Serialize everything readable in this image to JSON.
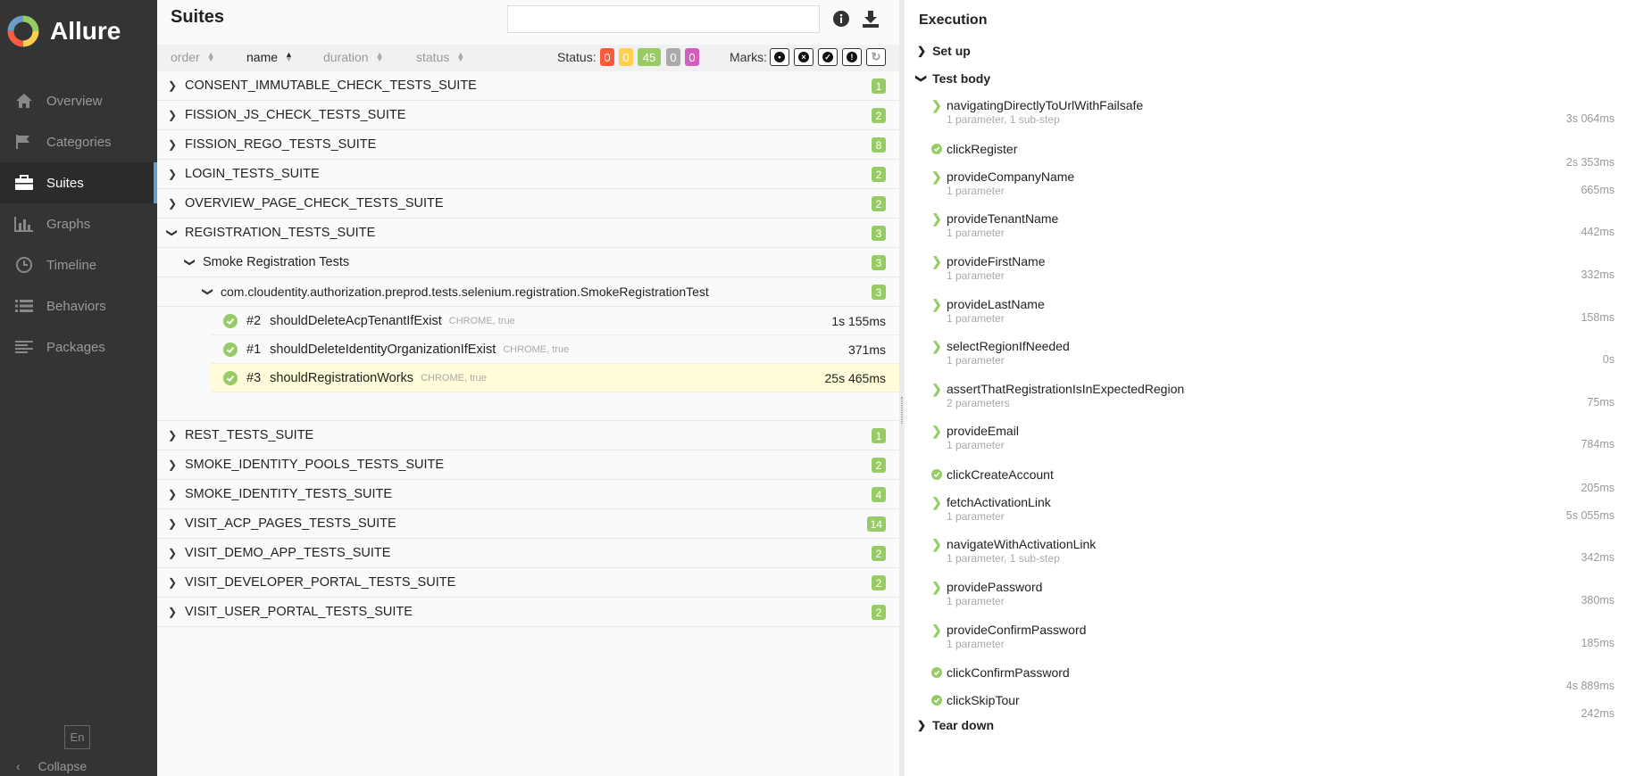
{
  "brand": {
    "name": "Allure"
  },
  "nav": [
    {
      "label": "Overview",
      "icon": "home-icon"
    },
    {
      "label": "Categories",
      "icon": "flag-icon"
    },
    {
      "label": "Suites",
      "icon": "briefcase-icon",
      "active": true
    },
    {
      "label": "Graphs",
      "icon": "bar-chart-icon"
    },
    {
      "label": "Timeline",
      "icon": "clock-icon"
    },
    {
      "label": "Behaviors",
      "icon": "list-icon"
    },
    {
      "label": "Packages",
      "icon": "align-left-icon"
    }
  ],
  "sidebar_footer": {
    "lang": "En",
    "collapse": "Collapse"
  },
  "suites": {
    "title": "Suites",
    "search_value": "",
    "sort": {
      "order": "order",
      "name": "name",
      "duration": "duration",
      "status": "status"
    },
    "status_label": "Status:",
    "status_counts": [
      {
        "value": "0",
        "color": "#fd5a3e"
      },
      {
        "value": "0",
        "color": "#ffd050"
      },
      {
        "value": "45",
        "color": "#97cc64"
      },
      {
        "value": "0",
        "color": "#aaaaaa"
      },
      {
        "value": "0",
        "color": "#d35ebe"
      }
    ],
    "marks_label": "Marks:",
    "before_suites": [
      {
        "name": "CONSENT_IMMUTABLE_CHECK_TESTS_SUITE",
        "count": "1"
      },
      {
        "name": "FISSION_JS_CHECK_TESTS_SUITE",
        "count": "2"
      },
      {
        "name": "FISSION_REGO_TESTS_SUITE",
        "count": "8"
      },
      {
        "name": "LOGIN_TESTS_SUITE",
        "count": "2"
      },
      {
        "name": "OVERVIEW_PAGE_CHECK_TESTS_SUITE",
        "count": "2"
      }
    ],
    "expanded_suite": {
      "name": "REGISTRATION_TESTS_SUITE",
      "count": "3"
    },
    "sub_suite": {
      "name": "Smoke Registration Tests",
      "count": "3"
    },
    "test_class": {
      "name": "com.cloudentity.authorization.preprod.tests.selenium.registration.SmokeRegistrationTest",
      "count": "3"
    },
    "tests": [
      {
        "order": "#2",
        "name": "shouldDeleteAcpTenantIfExist",
        "params": "CHROME, true",
        "duration": "1s 155ms"
      },
      {
        "order": "#1",
        "name": "shouldDeleteIdentityOrganizationIfExist",
        "params": "CHROME, true",
        "duration": "371ms"
      },
      {
        "order": "#3",
        "name": "shouldRegistrationWorks",
        "params": "CHROME, true",
        "duration": "25s 465ms",
        "selected": true
      }
    ],
    "after_suites": [
      {
        "name": "REST_TESTS_SUITE",
        "count": "1"
      },
      {
        "name": "SMOKE_IDENTITY_POOLS_TESTS_SUITE",
        "count": "2"
      },
      {
        "name": "SMOKE_IDENTITY_TESTS_SUITE",
        "count": "4"
      },
      {
        "name": "VISIT_ACP_PAGES_TESTS_SUITE",
        "count": "14"
      },
      {
        "name": "VISIT_DEMO_APP_TESTS_SUITE",
        "count": "2"
      },
      {
        "name": "VISIT_DEVELOPER_PORTAL_TESTS_SUITE",
        "count": "2"
      },
      {
        "name": "VISIT_USER_PORTAL_TESTS_SUITE",
        "count": "2"
      }
    ]
  },
  "execution": {
    "title": "Execution",
    "setup": "Set up",
    "body": "Test body",
    "teardown": "Tear down",
    "steps": [
      {
        "name": "navigatingDirectlyToUrlWithFailsafe",
        "sub": "1 parameter, 1 sub-step",
        "duration": "3s 064ms",
        "kind": "arrow"
      },
      {
        "name": "clickRegister",
        "sub": "",
        "duration": "2s 353ms",
        "kind": "check"
      },
      {
        "name": "provideCompanyName",
        "sub": "1 parameter",
        "duration": "665ms",
        "kind": "arrow"
      },
      {
        "name": "provideTenantName",
        "sub": "1 parameter",
        "duration": "442ms",
        "kind": "arrow"
      },
      {
        "name": "provideFirstName",
        "sub": "1 parameter",
        "duration": "332ms",
        "kind": "arrow"
      },
      {
        "name": "provideLastName",
        "sub": "1 parameter",
        "duration": "158ms",
        "kind": "arrow"
      },
      {
        "name": "selectRegionIfNeeded",
        "sub": "1 parameter",
        "duration": "0s",
        "kind": "arrow"
      },
      {
        "name": "assertThatRegistrationIsInExpectedRegion",
        "sub": "2 parameters",
        "duration": "75ms",
        "kind": "arrow"
      },
      {
        "name": "provideEmail",
        "sub": "1 parameter",
        "duration": "784ms",
        "kind": "arrow"
      },
      {
        "name": "clickCreateAccount",
        "sub": "",
        "duration": "205ms",
        "kind": "check"
      },
      {
        "name": "fetchActivationLink",
        "sub": "1 parameter",
        "duration": "5s 055ms",
        "kind": "arrow"
      },
      {
        "name": "navigateWithActivationLink",
        "sub": "1 parameter, 1 sub-step",
        "duration": "342ms",
        "kind": "arrow"
      },
      {
        "name": "providePassword",
        "sub": "1 parameter",
        "duration": "380ms",
        "kind": "arrow"
      },
      {
        "name": "provideConfirmPassword",
        "sub": "1 parameter",
        "duration": "185ms",
        "kind": "arrow"
      },
      {
        "name": "clickConfirmPassword",
        "sub": "",
        "duration": "4s 889ms",
        "kind": "check"
      },
      {
        "name": "clickSkipTour",
        "sub": "",
        "duration": "242ms",
        "kind": "check"
      }
    ]
  }
}
